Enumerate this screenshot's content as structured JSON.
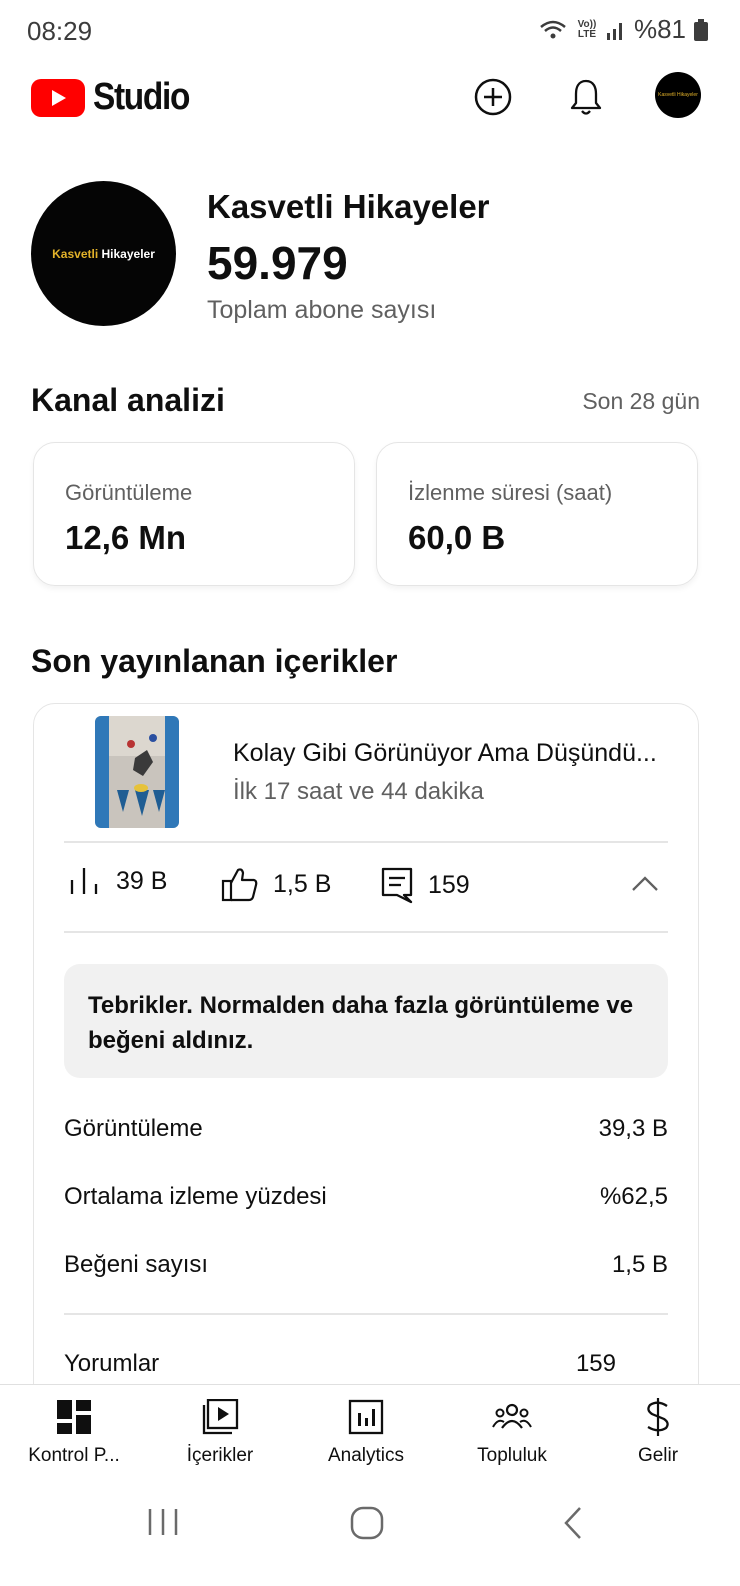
{
  "status_bar": {
    "time": "08:29",
    "network": "Vo)) LTE",
    "battery": "%81"
  },
  "app_bar": {
    "logo_text": "Studio",
    "icons": [
      "add-circle-icon",
      "bell-icon",
      "avatar"
    ],
    "avatar_text": "Kasvetli Hikayeler"
  },
  "channel": {
    "avatar_text_1": "Kasvetli",
    "avatar_text_2": "Hikayeler",
    "name": "Kasvetli Hikayeler",
    "subscribers": "59.979",
    "subscribers_label": "Toplam abone sayısı"
  },
  "analytics": {
    "title": "Kanal analizi",
    "period": "Son 28 gün",
    "cards": [
      {
        "label": "Görüntüleme",
        "value": "12,6 Mn"
      },
      {
        "label": "İzlenme süresi (saat)",
        "value": "60,0 B"
      }
    ]
  },
  "recent": {
    "title": "Son yayınlanan içerikler",
    "video_title": "Kolay Gibi Görünüyor Ama Düşündü...",
    "video_time": "İlk 17 saat ve 44 dakika",
    "metrics": {
      "views": "39 B",
      "likes": "1,5 B",
      "comments": "159"
    },
    "congrats": "Tebrikler. Normalden daha fazla görüntüleme ve beğeni aldınız.",
    "rows": [
      {
        "label": "Görüntüleme",
        "value": "39,3 B"
      },
      {
        "label": "Ortalama izleme yüzdesi",
        "value": "%62,5"
      },
      {
        "label": "Beğeni sayısı",
        "value": "1,5 B"
      },
      {
        "label": "Yorumlar",
        "value": "159"
      }
    ]
  },
  "bottom_nav": [
    {
      "label": "Kontrol P...",
      "icon": "dashboard-icon"
    },
    {
      "label": "İçerikler",
      "icon": "content-icon"
    },
    {
      "label": "Analytics",
      "icon": "analytics-icon"
    },
    {
      "label": "Topluluk",
      "icon": "community-icon"
    },
    {
      "label": "Gelir",
      "icon": "dollar-icon"
    }
  ],
  "colors": {
    "brand": "#ff0000",
    "secondary_text": "#606060",
    "accent_gold": "#e3b22a"
  }
}
